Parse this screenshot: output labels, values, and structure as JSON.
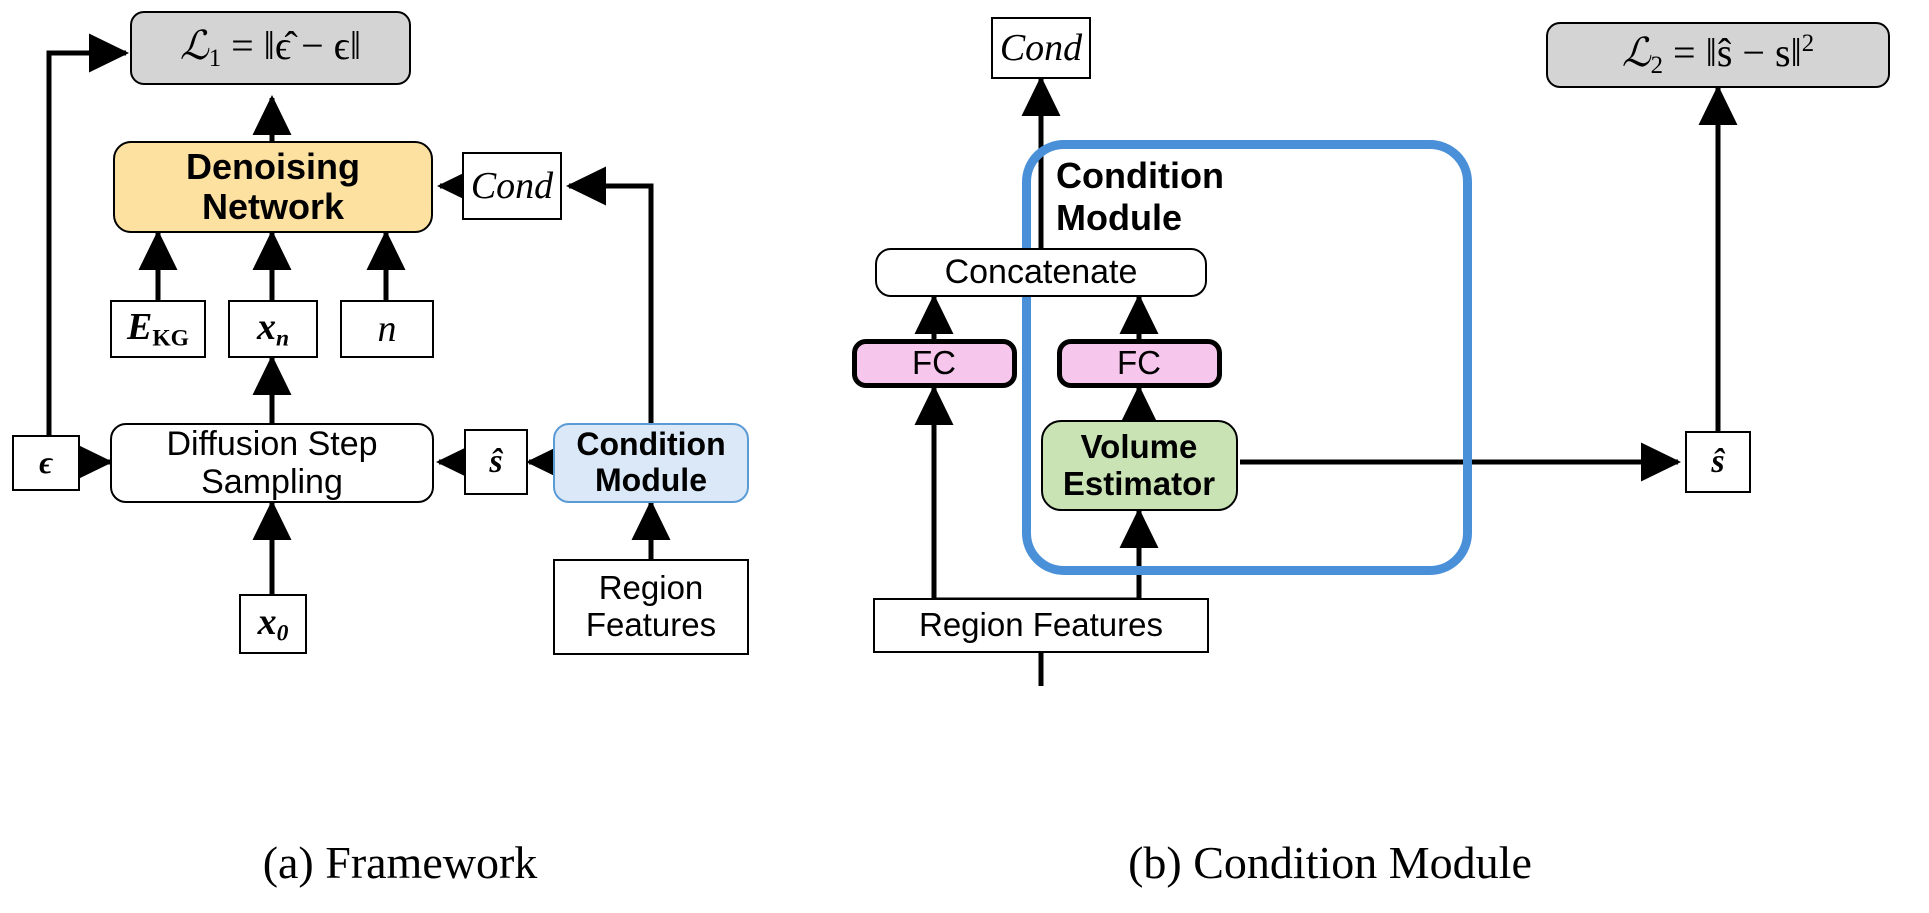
{
  "figure": {
    "panels": [
      {
        "id": "a",
        "caption": "(a) Framework"
      },
      {
        "id": "b",
        "caption": "(b) Condition Module"
      }
    ]
  },
  "colors": {
    "denoising_network_fill": "#fce1a0",
    "condition_module_fill": "#dbe8f7",
    "condition_module_border": "#5b9bd5",
    "container_border": "#4a90d9",
    "fc_fill": "#f7c6ec",
    "volume_estimator_fill": "#c9e3b4",
    "loss_fill": "#d4d4d4",
    "stroke": "#000000"
  },
  "panel_a": {
    "loss1": {
      "lead": "ℒ",
      "sub": "1",
      "rest": "= ‖ϵ̂ − ϵ‖"
    },
    "denoising_network": {
      "line1": "Denoising",
      "line2": "Network"
    },
    "cond": "Cond",
    "e_kg": {
      "lead": "E",
      "sub": "KG"
    },
    "x_n": {
      "lead": "x",
      "sub": "n"
    },
    "n": "n",
    "epsilon": "ϵ",
    "diffusion_step": {
      "line1": "Diffusion Step",
      "line2": "Sampling"
    },
    "s_hat": "ŝ",
    "condition_module": {
      "line1": "Condition",
      "line2": "Module"
    },
    "x_0": {
      "lead": "x",
      "sub": "0"
    },
    "region_features": {
      "line1": "Region",
      "line2": "Features"
    }
  },
  "panel_b": {
    "cond": "Cond",
    "loss2": {
      "lead": "ℒ",
      "sub": "2",
      "rest": "= ‖ŝ − s‖",
      "sup": "2"
    },
    "container_label": {
      "line1": "Condition",
      "line2": "Module"
    },
    "concatenate": "Concatenate",
    "fc_left": "FC",
    "fc_right": "FC",
    "volume_estimator": {
      "line1": "Volume",
      "line2": "Estimator"
    },
    "s_hat": "ŝ",
    "region_features": "Region Features"
  }
}
